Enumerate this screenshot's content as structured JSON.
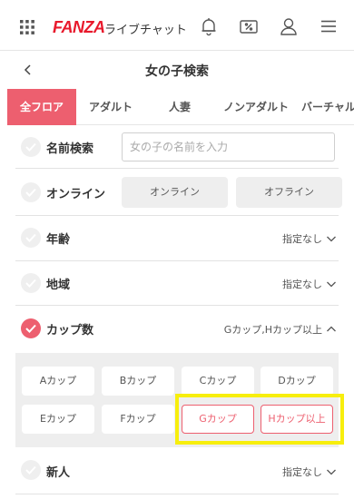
{
  "header": {
    "logo_text": "FANZA",
    "logo_subtitle": "ライブチャット",
    "icons": [
      "grid-menu-icon",
      "bell-icon",
      "coupon-icon",
      "user-icon",
      "hamburger-menu-icon"
    ],
    "brand_color": "#e8192c"
  },
  "title_bar": {
    "title": "女の子検索",
    "back_icon": "chevron-left-icon"
  },
  "tabs": [
    {
      "label": "全フロア",
      "active": true
    },
    {
      "label": "アダルト",
      "active": false
    },
    {
      "label": "人妻",
      "active": false
    },
    {
      "label": "ノンアダルト",
      "active": false
    },
    {
      "label": "バーチャル",
      "active": false
    }
  ],
  "filters": {
    "name": {
      "label": "名前検索",
      "placeholder": "女の子の名前を入力",
      "value": ""
    },
    "online": {
      "label": "オンライン",
      "options": [
        "オンライン",
        "オフライン"
      ]
    },
    "age": {
      "label": "年齢",
      "value": "指定なし"
    },
    "region": {
      "label": "地域",
      "value": "指定なし"
    },
    "cup": {
      "label": "カップ数",
      "value": "Gカップ,Hカップ以上",
      "checked": true,
      "options": [
        {
          "label": "Aカップ",
          "selected": false
        },
        {
          "label": "Bカップ",
          "selected": false
        },
        {
          "label": "Cカップ",
          "selected": false
        },
        {
          "label": "Dカップ",
          "selected": false
        },
        {
          "label": "Eカップ",
          "selected": false
        },
        {
          "label": "Fカップ",
          "selected": false
        },
        {
          "label": "Gカップ",
          "selected": true
        },
        {
          "label": "Hカップ以上",
          "selected": true
        }
      ]
    },
    "newcomer": {
      "label": "新人",
      "value": "指定なし"
    }
  },
  "colors": {
    "accent": "#ed5f6f",
    "panel_bg": "#eeeeee",
    "highlight": "#f7ee0d"
  }
}
